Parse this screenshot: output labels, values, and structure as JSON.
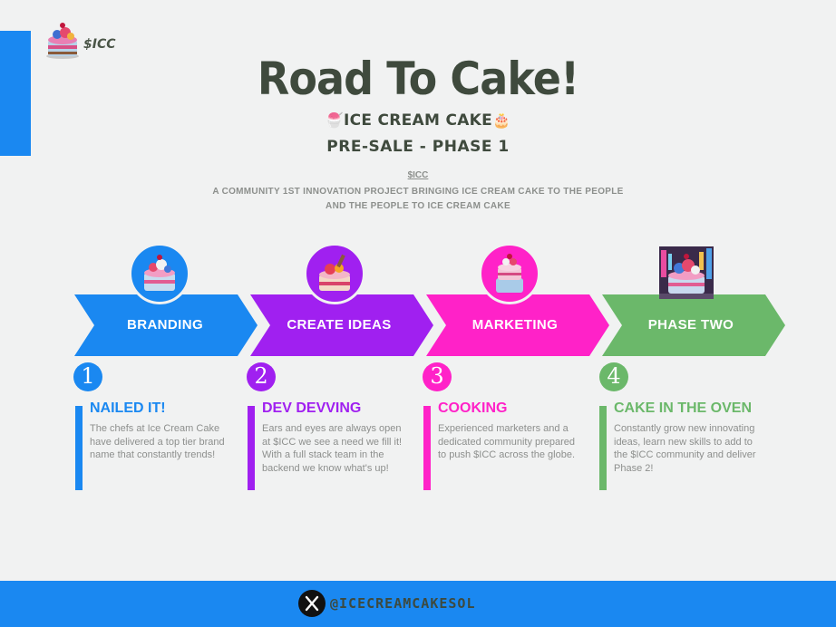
{
  "logo": {
    "text": "$ICC"
  },
  "header": {
    "title": "Road To Cake!",
    "subtitle_emoji_left": "🍧",
    "subtitle": "ICE CREAM CAKE",
    "subtitle_emoji_right": "🎂",
    "phase": "PRE-SALE - PHASE 1",
    "ticker": "$ICC",
    "tagline_line1": "A COMMUNITY 1ST INNOVATION PROJECT BRINGING ICE CREAM CAKE TO THE PEOPLE",
    "tagline_line2": "AND THE PEOPLE TO ICE CREAM CAKE"
  },
  "colors": {
    "blue": "#1a88f1",
    "purple": "#a020f0",
    "pink": "#ff22c8",
    "green": "#6bb86a",
    "background": "#f1f2f2"
  },
  "roadmap": [
    {
      "arrow_label": "BRANDING",
      "number": "1",
      "title": "NAILED IT!",
      "text": "The chefs at Ice Cream Cake have delivered a top tier brand name that constantly trends!",
      "color": "#1a88f1",
      "icon": "cake-icon"
    },
    {
      "arrow_label": "CREATE IDEAS",
      "number": "2",
      "title": "DEV DEVVING",
      "text": "Ears and eyes are always open at $ICC we see a need we fill it! With a full stack team in the backend we know what's up!",
      "color": "#a020f0",
      "icon": "cake-icon"
    },
    {
      "arrow_label": "MARKETING",
      "number": "3",
      "title": "COOKING",
      "text": "Experienced marketers and a dedicated community prepared to push $ICC across the globe.",
      "color": "#ff22c8",
      "icon": "cake-icon"
    },
    {
      "arrow_label": "PHASE TWO",
      "number": "4",
      "title": "CAKE IN THE OVEN",
      "text": "Constantly grow new innovating ideas, learn new skills to add to the $ICC community and deliver Phase 2!",
      "color": "#6bb86a",
      "icon": "cake-photo"
    }
  ],
  "footer": {
    "handle": "@ICECREAMCAKESOL",
    "icon": "x-icon"
  }
}
